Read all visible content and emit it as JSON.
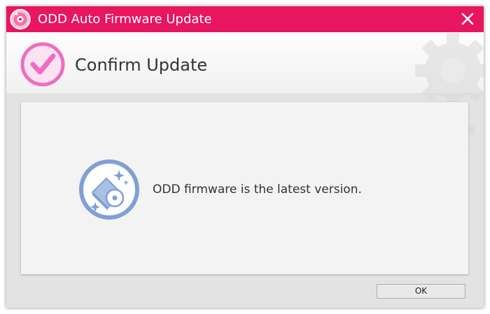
{
  "window": {
    "title": "ODD Auto Firmware Update",
    "title_bar_color": "#e8155f",
    "close_icon": "close-icon"
  },
  "header": {
    "icon": "checkmark-circle-icon",
    "title": "Confirm Update"
  },
  "content": {
    "icon": "optical-drive-sparkle-icon",
    "message": "ODD firmware is the latest version."
  },
  "footer": {
    "ok_label": "OK"
  },
  "colors": {
    "accent_pink": "#e8155f",
    "check_pink": "#ef6dc0",
    "drive_blue": "#7f9fd5"
  }
}
